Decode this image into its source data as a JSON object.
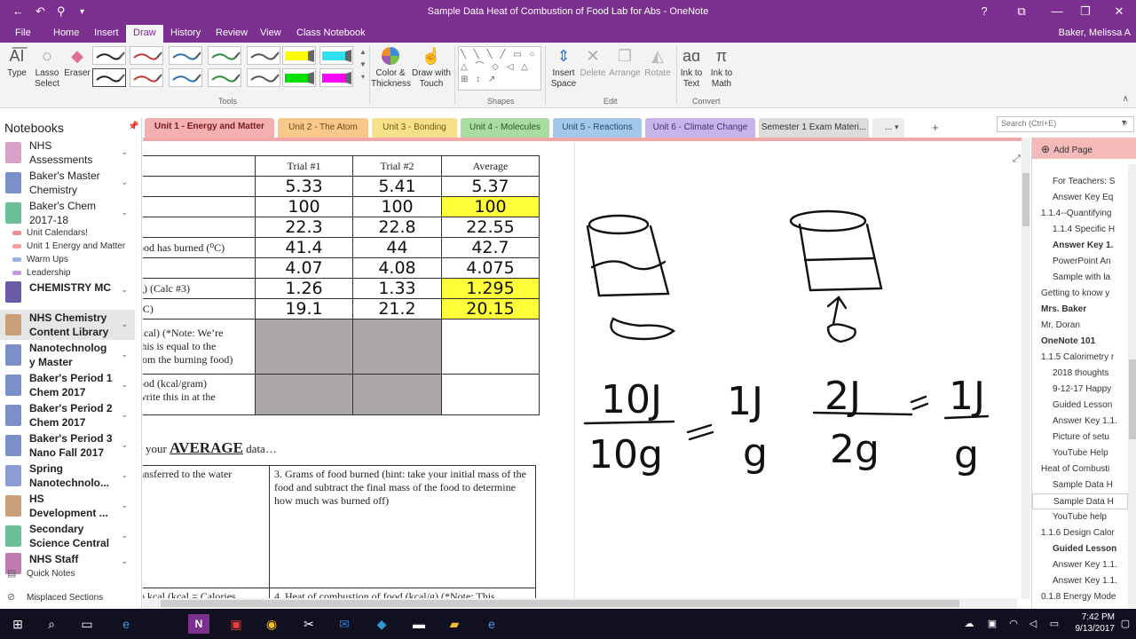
{
  "window": {
    "title": "Sample Data Heat of Combustion of Food Lab for Abs - OneNote",
    "help": "?",
    "minimize": "—",
    "restore": "❐",
    "close": "✕",
    "ribbon_display": "⧉"
  },
  "quick_access": {
    "back": "←",
    "undo": "↶",
    "pin": "⚲",
    "customize": "▾"
  },
  "menu": {
    "tabs": [
      "File",
      "Home",
      "Insert",
      "Draw",
      "History",
      "Review",
      "View",
      "Class Notebook"
    ],
    "active": "Draw",
    "user": "Baker, Melissa A"
  },
  "ribbon": {
    "type_label": "Type",
    "lasso_label": "Lasso Select",
    "lasso_l1": "Lasso",
    "lasso_l2": "Select",
    "eraser_label": "Eraser",
    "tools_group": "Tools",
    "color_thickness_l1": "Color &",
    "color_thickness_l2": "Thickness",
    "draw_touch_l1": "Draw with",
    "draw_touch_l2": "Touch",
    "shapes_group": "Shapes",
    "shapes_glyphs": "╲ ╲ ╲ ╱ ▭ ○ △ ⌒ ◇ ◁ △ ⊞ ↕ ↗",
    "insert_space_l1": "Insert",
    "insert_space_l2": "Space",
    "delete_label": "Delete",
    "arrange_label": "Arrange",
    "rotate_label": "Rotate",
    "edit_group": "Edit",
    "ink_text_l1": "Ink to",
    "ink_text_l2": "Text",
    "ink_math_l1": "Ink to",
    "ink_math_l2": "Math",
    "convert_group": "Convert",
    "pen_colors": [
      "#222222",
      "#c0392b",
      "#2e6ea8",
      "#2e8b3a",
      "#555555",
      "#ffff00",
      "#222222",
      "#c0392b",
      "#2e6ea8",
      "#2e8b3a",
      "#555555",
      "#00e000"
    ],
    "highlighter_colors": [
      "#33e0f0",
      "#ff00ff"
    ]
  },
  "notebooks": {
    "header": "Notebooks",
    "items": [
      {
        "name_l1": "NHS",
        "name_l2": "Assessments",
        "color": "#d9a0c8",
        "bold": false
      },
      {
        "name_l1": "Baker's Master",
        "name_l2": "Chemistry",
        "color": "#7d8fc9",
        "bold": false
      },
      {
        "name_l1": "Baker's Chem",
        "name_l2": "2017-18",
        "color": "#6dbf9a",
        "bold": false
      },
      {
        "name_l1": "CHEMISTRY MC",
        "name_l2": "",
        "color": "#6a5aa8",
        "bold": true
      },
      {
        "name_l1": "NHS Chemistry",
        "name_l2": "Content Library",
        "color": "#c9a07a",
        "bold": true
      },
      {
        "name_l1": "Nanotechnolog",
        "name_l2": "y Master",
        "color": "#7d8fc9",
        "bold": true
      },
      {
        "name_l1": "Baker's Period 1",
        "name_l2": "Chem 2017",
        "color": "#7d8fc9",
        "bold": true
      },
      {
        "name_l1": "Baker's Period 2",
        "name_l2": "Chem 2017",
        "color": "#7d8fc9",
        "bold": true
      },
      {
        "name_l1": "Baker's Period 3",
        "name_l2": "Nano Fall 2017",
        "color": "#7d8fc9",
        "bold": true
      },
      {
        "name_l1": "Spring",
        "name_l2": "Nanotechnolo...",
        "color": "#8d9ed6",
        "bold": true
      },
      {
        "name_l1": "HS",
        "name_l2": "Development ...",
        "color": "#c9a07a",
        "bold": true
      },
      {
        "name_l1": "Secondary",
        "name_l2": "Science Central",
        "color": "#6dbf9a",
        "bold": true
      },
      {
        "name_l1": "NHS Staff",
        "name_l2": "",
        "color": "#c07ab0",
        "bold": true
      }
    ],
    "sections": [
      {
        "name": "Unit Calendars!",
        "color": "#ef8f8f"
      },
      {
        "name": "Unit 1 Energy and Matter",
        "color": "#f4a0a0"
      },
      {
        "name": "Warm Ups",
        "color": "#9ab0e8"
      },
      {
        "name": "Leadership",
        "color": "#c49ae0"
      }
    ],
    "quick_notes": "Quick Notes",
    "misplaced": "Misplaced Sections"
  },
  "section_tabs": [
    {
      "label": "Unit 1 - Energy and Matter",
      "color": "#f4b0b0",
      "text": "#7a1a1a",
      "bold": true
    },
    {
      "label": "Unit 2 - The Atom",
      "color": "#f9c98c",
      "text": "#6b4a10",
      "bold": false
    },
    {
      "label": "Unit 3 - Bonding",
      "color": "#f6e08a",
      "text": "#6b5a10",
      "bold": false
    },
    {
      "label": "Unit 4 - Molecules",
      "color": "#a8dca0",
      "text": "#2c5a24",
      "bold": false
    },
    {
      "label": "Unit 5 - Reactions",
      "color": "#a4c8ea",
      "text": "#1f4a74",
      "bold": false
    },
    {
      "label": "Unit 6 - Climate Change",
      "color": "#c7b4ea",
      "text": "#4a2f7a",
      "bold": false
    },
    {
      "label": "Semester 1 Exam Materi...",
      "color": "#dcdcdc",
      "text": "#333333",
      "bold": false
    },
    {
      "label": "...",
      "color": "#ececec",
      "text": "#333333",
      "bold": false
    }
  ],
  "add_section": "+",
  "search": {
    "placeholder": "Search (Ctrl+E)"
  },
  "table": {
    "headers": [
      "Trial #1",
      "Trial #2",
      "Average"
    ],
    "rows": [
      {
        "label": "",
        "t1": "5.33",
        "t2": "5.41",
        "avg": "5.37",
        "avg_hl": false
      },
      {
        "label": "",
        "t1": "100",
        "t2": "100",
        "avg": "100",
        "avg_hl": true
      },
      {
        "label": ")",
        "t1": "22.3",
        "t2": "22.8",
        "avg": "22.55",
        "avg_hl": false
      },
      {
        "label": "ood has burned (⁰C)",
        "t1": "41.4",
        "t2": "44",
        "avg": "42.7",
        "avg_hl": false
      },
      {
        "label": "",
        "t1": "4.07",
        "t2": "4.08",
        "avg": "4.075",
        "avg_hl": false
      },
      {
        "label": "g) (Calc #3)",
        "t1": "1.26",
        "t2": "1.33",
        "avg": "1.295",
        "avg_hl": true
      },
      {
        "label": "⁰C)",
        "t1": "19.1",
        "t2": "21.2",
        "avg": "20.15",
        "avg_hl": true
      }
    ],
    "kcal_label_l1": "kcal) (*Note: We’re",
    "kcal_label_l2": "this is equal to the",
    "kcal_label_l3": "rom the burning food)",
    "kcalg_label_l1": "ood (kcal/gram)",
    "kcalg_label_l2": "write this in at the"
  },
  "avg_line": {
    "pre": "your ",
    "big": "AVERAGE",
    "post": " data…"
  },
  "questions": {
    "q1": "ansferred to the water",
    "q3": "3. Grams of food burned (hint: take your initial mass of the food and subtract the final mass of the food to determine how much was burned off)",
    "q2": "o kcal (kcal = Calories",
    "q4": "4. Heat of combustion of food (kcal/g) (*Note: This"
  },
  "ink": {
    "frac1_num": "10J",
    "frac1_den": "10g",
    "eq": "=",
    "frac2_num": "1J",
    "frac2_den": "g",
    "frac3_num": "2J",
    "frac3_den": "2g",
    "frac4_num": "1J",
    "frac4_den": "g"
  },
  "pages": {
    "add": "Add Page",
    "items": [
      {
        "name": "For Teachers: S",
        "indent": 1,
        "bold": false
      },
      {
        "name": "Answer Key Eq",
        "indent": 1,
        "bold": false
      },
      {
        "name": "1.1.4--Quantifying",
        "indent": 0,
        "bold": false
      },
      {
        "name": "1.1.4 Specific H",
        "indent": 1,
        "bold": false
      },
      {
        "name": "Answer Key 1.",
        "indent": 1,
        "bold": true
      },
      {
        "name": "PowerPoint An",
        "indent": 1,
        "bold": false
      },
      {
        "name": "Sample with la",
        "indent": 1,
        "bold": false
      },
      {
        "name": "Getting to know y",
        "indent": 0,
        "bold": false
      },
      {
        "name": "Mrs. Baker",
        "indent": 0,
        "bold": true
      },
      {
        "name": "Mr. Doran",
        "indent": 0,
        "bold": false
      },
      {
        "name": "OneNote 101",
        "indent": 0,
        "bold": true
      },
      {
        "name": "1.1.5 Calorimetry r",
        "indent": 0,
        "bold": false
      },
      {
        "name": "2018 thoughts",
        "indent": 1,
        "bold": false
      },
      {
        "name": "9-12-17 Happy",
        "indent": 1,
        "bold": false
      },
      {
        "name": "Guided Lesson",
        "indent": 1,
        "bold": false
      },
      {
        "name": "Answer Key 1.1.",
        "indent": 1,
        "bold": false
      },
      {
        "name": "Picture of setu",
        "indent": 1,
        "bold": false
      },
      {
        "name": "YouTube Help",
        "indent": 1,
        "bold": false
      },
      {
        "name": "Heat of Combusti",
        "indent": 0,
        "bold": false
      },
      {
        "name": "Sample Data H",
        "indent": 1,
        "bold": false
      },
      {
        "name": "Sample Data H",
        "indent": 1,
        "bold": false,
        "current": true
      },
      {
        "name": "YouTube help",
        "indent": 1,
        "bold": false
      },
      {
        "name": "1.1.6 Design Calor",
        "indent": 0,
        "bold": false
      },
      {
        "name": "Guided Lesson",
        "indent": 1,
        "bold": true
      },
      {
        "name": "Answer Key 1.1.",
        "indent": 1,
        "bold": false
      },
      {
        "name": "Answer Key 1.1.",
        "indent": 1,
        "bold": false
      },
      {
        "name": "0.1.8 Energy Mode",
        "indent": 0,
        "bold": false
      }
    ]
  },
  "taskbar": {
    "icons": [
      "windows-start-icon",
      "search-icon",
      "task-view-icon",
      "edge-icon",
      "onenote-icon",
      "app-icon",
      "chrome-icon",
      "snipping-icon",
      "outlook-icon",
      "app2-icon",
      "explorer-icon",
      "ie-icon"
    ],
    "time": "7:42 PM",
    "date": "9/13/2017"
  }
}
